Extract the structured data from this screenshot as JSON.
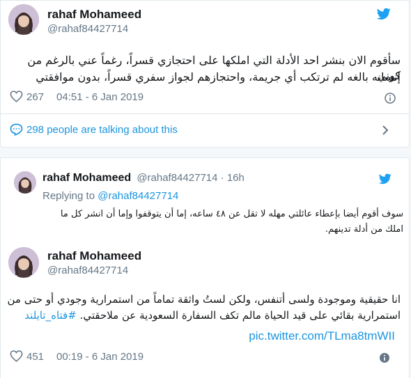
{
  "colors": {
    "brand": "#1da1f2",
    "link": "#1b95e0",
    "muted": "#657786",
    "text": "#14171a"
  },
  "tweet1": {
    "name": "rahaf Mohameed",
    "handle": "@rahaf84427714",
    "text_lines": [
      "سأقوم الان بنشر احد الأدلة التي املكها على احتجازي قسراً، رغماً عني بالرغم من كوني",
      "إنسانه بالغه لم ترتكب أي جريمة، واحتجازهم لجواز سفري قسراً، بدون موافقتي"
    ],
    "likes": "267",
    "timestamp": "04:51 - 6 Jan 2019",
    "talking": "298 people are talking about this"
  },
  "tweet2": {
    "name": "rahaf Mohameed",
    "handle": "@rahaf84427714",
    "separator": "·",
    "age": "16h",
    "replying_prefix": "Replying to",
    "replying_handle": "@rahaf84427714",
    "text_lines": [
      "سوف أقوم أيضا بإعطاء عائلتي مهله لا تقل عن ٤٨ ساعه، إما أن يتوقفوا وإما أن انشر كل ما",
      "املك من أدلة تدينهم."
    ]
  },
  "tweet3": {
    "name": "rahaf Mohameed",
    "handle": "@rahaf84427714",
    "text_line1": "انا حقيقية وموجودة ولسى أتنفس، ولكن لستُ واثقة تماماً من استمرارية وجودي أو حتى من",
    "text_line2": "استمرارية بقائي على قيد الحياة مالم تكف السفارة السعودية عن ملاحقتي.",
    "hashtag": "#فتاه_تايلند",
    "pic_link": "pic.twitter.com/TLma8tmWII",
    "likes": "451",
    "timestamp": "00:19 - 6 Jan 2019"
  },
  "icons": {
    "bird": "twitter-bird-icon",
    "heart": "heart-icon",
    "info": "info-icon",
    "chat": "chat-bubble-icon",
    "chevron": "chevron-right-icon"
  }
}
